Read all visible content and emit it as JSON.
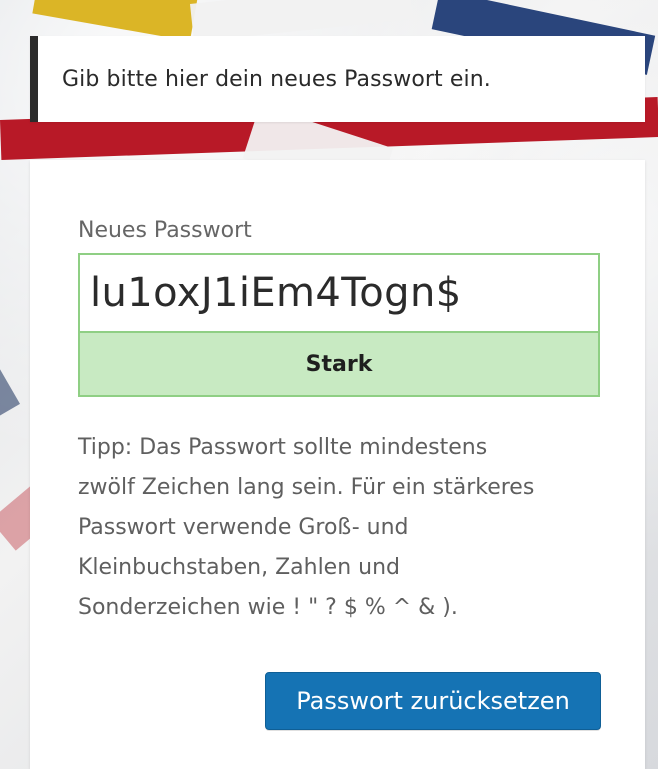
{
  "notice": {
    "text": "Gib bitte hier dein neues Passwort ein."
  },
  "form": {
    "label": "Neues Passwort",
    "password_value": "lu1oxJ1iEm4Togn$",
    "strength_label": "Stark",
    "hint": "Tipp: Das Passwort sollte mindestens\nzwölf Zeichen lang sein. Für ein stärkeres\nPasswort verwende Groß- und\nKleinbuchstaben, Zahlen und\nSonderzeichen wie ! \" ? $ % ^ & ).",
    "submit_label": "Passwort zurücksetzen"
  },
  "colors": {
    "notice_border": "#2b2b2b",
    "input_border": "#8fcf84",
    "strength_bg": "#c8eac2",
    "button_bg": "#1573b4"
  },
  "icons": {
    "background": "playing-cards-background"
  }
}
